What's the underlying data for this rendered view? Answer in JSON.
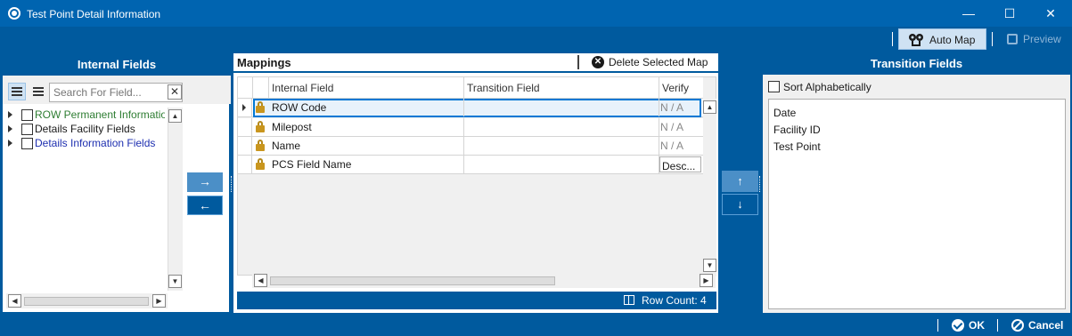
{
  "window": {
    "title": "Test Point Detail Information",
    "minimize_symbol": "—",
    "maximize_symbol": "☐",
    "close_symbol": "✕"
  },
  "toolbar": {
    "automap_label": "Auto Map",
    "preview_label": "Preview"
  },
  "left_panel": {
    "title": "Internal Fields",
    "search_placeholder": "Search For Field...",
    "search_clear": "✕",
    "tree_items": [
      {
        "label": "ROW Permanent Information",
        "color": "#2e7d32"
      },
      {
        "label": "Details Facility Fields",
        "color": "#1a1a1a"
      },
      {
        "label": "Details Information Fields",
        "color": "#1e2fb0"
      }
    ]
  },
  "transfer": {
    "move_right": "→",
    "move_left": "←",
    "move_up": "↑",
    "move_down": "↓"
  },
  "mappings": {
    "title": "Mappings",
    "delete_label": "Delete Selected Map",
    "delete_icon": "✕",
    "columns": [
      "Internal Field",
      "Transition Field",
      "Verify"
    ],
    "rows": [
      {
        "internal": "ROW Code",
        "transition": "",
        "verify": "N / A"
      },
      {
        "internal": "Milepost",
        "transition": "",
        "verify": "N / A"
      },
      {
        "internal": "Name",
        "transition": "",
        "verify": "N / A"
      },
      {
        "internal": "PCS Field Name",
        "transition": "",
        "verify": "Desc..."
      }
    ],
    "row_count_label": "Row Count:",
    "row_count": "4"
  },
  "right_panel": {
    "title": "Transition Fields",
    "sort_label": "Sort Alphabetically",
    "items": [
      "Date",
      "Facility ID",
      "Test Point"
    ]
  },
  "footer": {
    "ok_label": "OK",
    "cancel_label": "Cancel"
  },
  "colors": {
    "primary": "#005a9e",
    "accent_light": "#cfe2f3",
    "lock": "#c9961e"
  }
}
